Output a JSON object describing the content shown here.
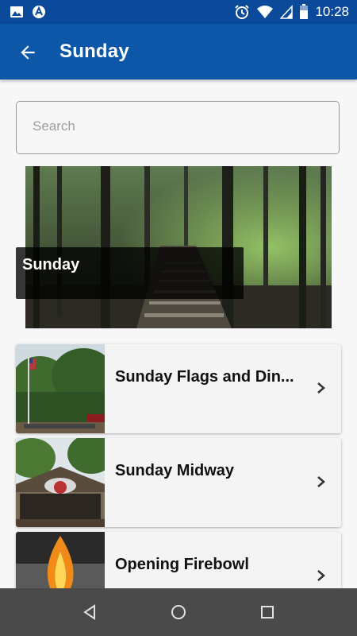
{
  "status_bar": {
    "time": "10:28",
    "left_icons": [
      "image-icon",
      "app-notification-icon"
    ],
    "right_icons": [
      "alarm-icon",
      "wifi-icon",
      "signal-icon",
      "battery-icon"
    ]
  },
  "app_bar": {
    "title": "Sunday",
    "back_icon": "arrow-back-icon"
  },
  "search": {
    "placeholder": "Search",
    "value": ""
  },
  "hero": {
    "caption": "Sunday"
  },
  "list": {
    "items": [
      {
        "label": "Sunday Flags and Din...",
        "thumb": "flags-photo"
      },
      {
        "label": "Sunday Midway",
        "thumb": "midway-photo"
      },
      {
        "label": "Opening Firebowl",
        "thumb": "firebowl-photo"
      }
    ]
  },
  "nav_bar": {
    "buttons": [
      "back-triangle-icon",
      "home-circle-icon",
      "recents-square-icon"
    ]
  },
  "colors": {
    "status_bar": "#0b4a9a",
    "app_bar": "#0d57a8",
    "background": "#f7f7f7",
    "nav_bar": "#4a4a4a"
  }
}
